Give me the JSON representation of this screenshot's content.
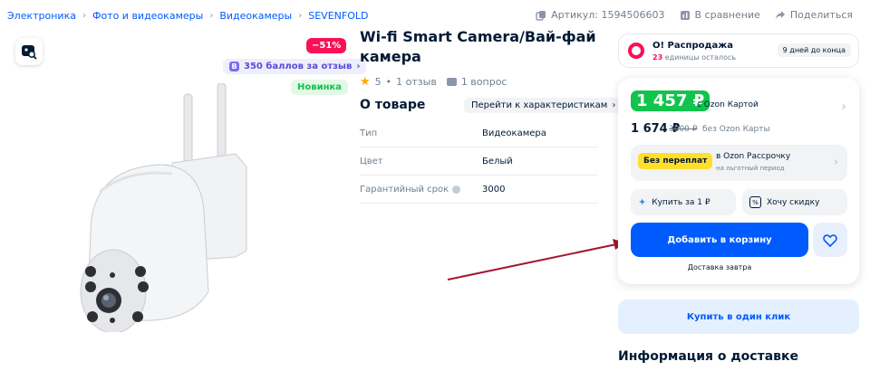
{
  "breadcrumb": [
    "Электроника",
    "Фото и видеокамеры",
    "Видеокамеры",
    "SEVENFOLD"
  ],
  "top_actions": {
    "article": "Артикул: 1594506603",
    "compare": "В сравнение",
    "share": "Поделиться"
  },
  "gallery": {
    "discount": "−51%",
    "points": "350 баллов за отзыв",
    "new_label": "Новинка"
  },
  "product": {
    "title": "Wi-fi Smart Camera/Вай-фай камера",
    "rating": "5",
    "reviews": "1 отзыв",
    "questions": "1 вопрос"
  },
  "about": {
    "heading": "О товаре",
    "go_to_specs": "Перейти к характеристикам",
    "specs": [
      {
        "key": "Тип",
        "value": "Видеокамера"
      },
      {
        "key": "Цвет",
        "value": "Белый"
      },
      {
        "key": "Гарантийный срок",
        "value": "3000"
      }
    ]
  },
  "sale": {
    "title": "О! Распродажа",
    "count": "23",
    "count_text": "единицы осталось",
    "days": "9 дней до конца"
  },
  "buy": {
    "card_price": "1 457 ₽",
    "card_note": "с Ozon Картой",
    "price": "1 674 ₽",
    "old_price": "3000 ₽",
    "price_note": "без Ozon Карты",
    "installment_tag": "Без переплат",
    "installment_line1": "в Ozon Рассрочку",
    "installment_line2": "на льготный период",
    "buy_for_1": "Купить за 1 ₽",
    "want_discount": "Хочу скидку",
    "add_to_cart": "Добавить в корзину",
    "delivery_note": "Доставка завтра"
  },
  "one_click": "Купить в один клик",
  "delivery_heading": "Информация о доставке",
  "colors": {
    "accent": "#005bff",
    "sale_pink": "#f91155",
    "price_green": "#10c44c",
    "installment_yellow": "#ffdf2b",
    "annotation_arrow": "#a01830"
  }
}
